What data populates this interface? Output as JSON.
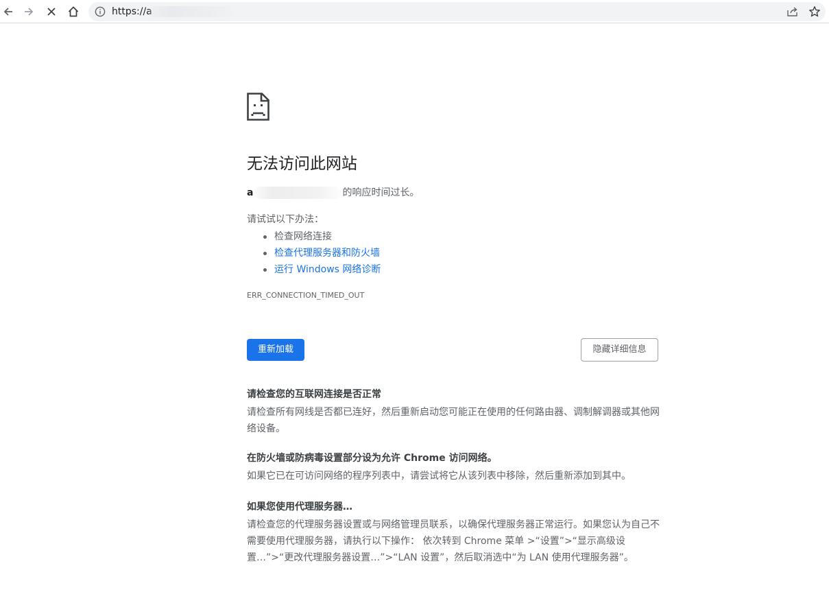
{
  "browser": {
    "url_visible": "https://a",
    "icons": {
      "back": "back-arrow-icon",
      "forward": "forward-arrow-icon",
      "stop": "close-icon",
      "home": "home-icon",
      "site_info": "info-icon",
      "share": "share-icon",
      "bookmark": "star-icon"
    }
  },
  "error_page": {
    "title": "无法访问此网站",
    "host_visible": "a",
    "summary_suffix": "的响应时间过长。",
    "try_label": "请试试以下办法：",
    "suggestions": [
      "检查网络连接",
      "检查代理服务器和防火墙",
      "运行 Windows 网络诊断"
    ],
    "error_code": "ERR_CONNECTION_TIMED_OUT",
    "reload_label": "重新加载",
    "details_label": "隐藏详细信息",
    "details": [
      {
        "heading": "请检查您的互联网连接是否正常",
        "body": "请检查所有网线是否都已连好，然后重新启动您可能正在使用的任何路由器、调制解调器或其他网络设备。"
      },
      {
        "heading": "在防火墙或防病毒设置部分设为允许 Chrome 访问网络。",
        "body": "如果它已在可访问网络的程序列表中，请尝试将它从该列表中移除，然后重新添加到其中。"
      },
      {
        "heading": "如果您使用代理服务器…",
        "body": "请检查您的代理服务器设置或与网络管理员联系，以确保代理服务器正常运行。如果您认为自己不需要使用代理服务器，请执行以下操作： 依次转到 Chrome 菜单 >“设置”>“显示高级设置…”>“更改代理服务器设置…”>“LAN 设置”，然后取消选中“为 LAN 使用代理服务器”。"
      }
    ]
  },
  "colors": {
    "link": "#1a73e8",
    "button_primary": "#1a73e8",
    "text_secondary": "#5f6368"
  }
}
